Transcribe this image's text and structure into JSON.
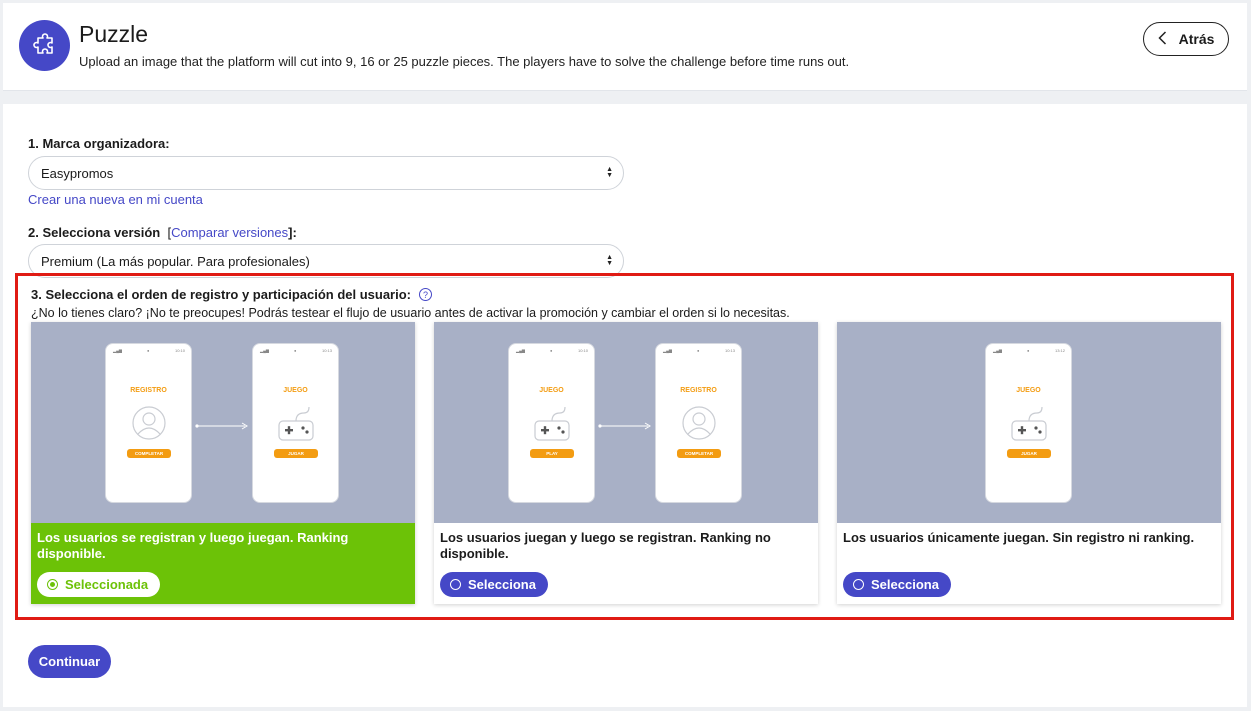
{
  "header": {
    "title": "Puzzle",
    "subtitle": "Upload an image that the platform will cut into 9, 16 or 25 puzzle pieces. The players have to solve the challenge before time runs out.",
    "back_label": "Atrás",
    "icon": "puzzle-piece-icon"
  },
  "step1": {
    "label": "1. Marca organizadora:",
    "selected": "Easypromos",
    "create_link": "Crear una nueva en mi cuenta"
  },
  "step2": {
    "label": "2. Selecciona versión",
    "bracket_open": "[",
    "compare_link": "Comparar versiones",
    "bracket_close": "]:",
    "selected": "Premium (La más popular. Para profesionales)"
  },
  "step3": {
    "label": "3. Selecciona el orden de registro y participación del usuario:",
    "help": "?",
    "hint": "¿No lo tienes claro? ¡No te preocupes! Podrás testear el flujo de usuario antes de activar la promoción y cambiar el orden si lo necesitas.",
    "cards": [
      {
        "description": "Los usuarios se registran y luego juegan. Ranking disponible.",
        "button": "Seleccionada",
        "phones": [
          {
            "title": "REGISTRO",
            "button": "COMPLETAR",
            "time": "10:10"
          },
          {
            "title": "JUEGO",
            "button": "JUGAR",
            "time": "10:13"
          }
        ]
      },
      {
        "description": "Los usuarios juegan y luego se registran. Ranking no disponible.",
        "button": "Selecciona",
        "phones": [
          {
            "title": "JUEGO",
            "button": "PLAY",
            "time": "10:10"
          },
          {
            "title": "REGISTRO",
            "button": "COMPLETAR",
            "time": "10:13"
          }
        ]
      },
      {
        "description": "Los usuarios únicamente juegan. Sin registro ni ranking.",
        "button": "Selecciona",
        "phones": [
          {
            "title": "JUEGO",
            "button": "JUGAR",
            "time": "13:12"
          }
        ]
      }
    ]
  },
  "continue_label": "Continuar",
  "colors": {
    "accent": "#4548c7",
    "selected_green": "#6cc207",
    "highlight_red": "#e01b14",
    "phone_accent": "#f39c12",
    "preview_bg": "#a8b0c6"
  }
}
